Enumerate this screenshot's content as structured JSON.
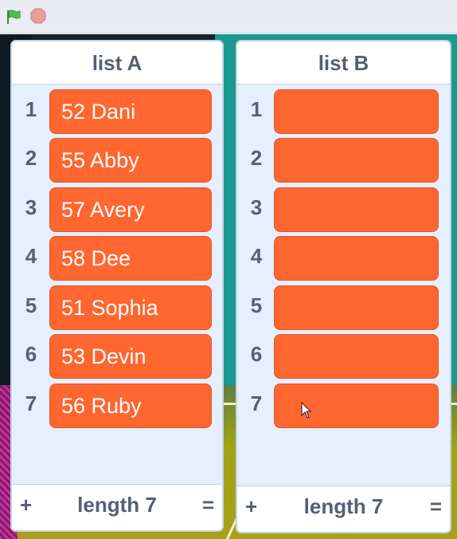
{
  "toolbar": {
    "green_flag_icon": "green-flag-icon",
    "stop_icon": "stop-icon"
  },
  "colors": {
    "cell": "#ff6630",
    "header_text": "#575e75",
    "monitor_bg": "#e5efff"
  },
  "lists": [
    {
      "title": "list A",
      "items": [
        {
          "index": "1",
          "value": "52 Dani"
        },
        {
          "index": "2",
          "value": "55 Abby"
        },
        {
          "index": "3",
          "value": "57 Avery"
        },
        {
          "index": "4",
          "value": "58 Dee"
        },
        {
          "index": "5",
          "value": "51 Sophia"
        },
        {
          "index": "6",
          "value": "53 Devin"
        },
        {
          "index": "7",
          "value": "56 Ruby"
        }
      ],
      "footer": {
        "add": "+",
        "length": "length 7",
        "resize": "="
      }
    },
    {
      "title": "list B",
      "items": [
        {
          "index": "1",
          "value": ""
        },
        {
          "index": "2",
          "value": ""
        },
        {
          "index": "3",
          "value": ""
        },
        {
          "index": "4",
          "value": ""
        },
        {
          "index": "5",
          "value": ""
        },
        {
          "index": "6",
          "value": ""
        },
        {
          "index": "7",
          "value": ""
        }
      ],
      "footer": {
        "add": "+",
        "length": "length 7",
        "resize": "="
      }
    }
  ]
}
